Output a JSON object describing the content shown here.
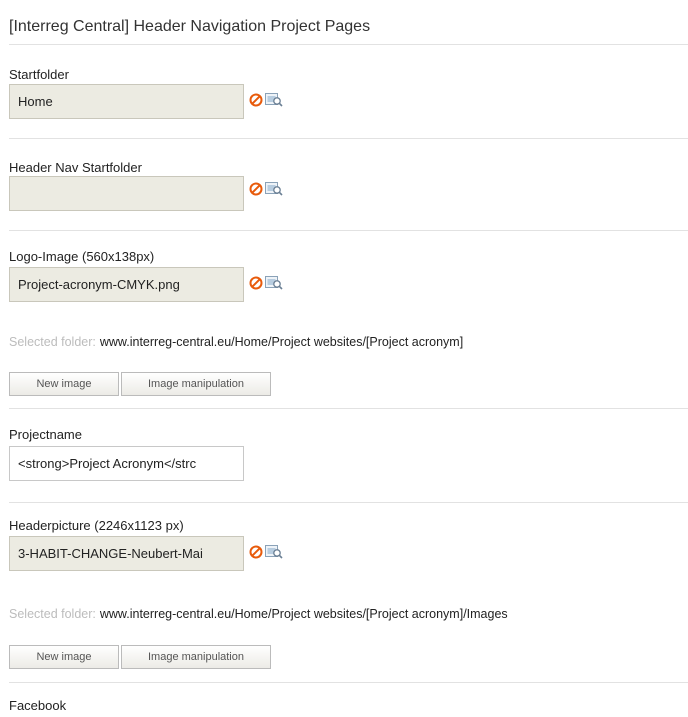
{
  "title": "[Interreg Central] Header Navigation Project Pages",
  "fields": {
    "startfolder": {
      "label": "Startfolder",
      "value": "Home"
    },
    "header_nav_startfolder": {
      "label": "Header Nav Startfolder",
      "value": ""
    },
    "logo_image": {
      "label": "Logo-Image (560x138px)",
      "value": "Project-acronym-CMYK.png"
    },
    "projectname": {
      "label": "Projectname",
      "value": "<strong>Project Acronym</strc"
    },
    "headerpicture": {
      "label": "Headerpicture (2246x1123 px)",
      "value": "3-HABIT-CHANGE-Neubert-Mai"
    },
    "facebook": {
      "label": "Facebook"
    }
  },
  "selected_folder": {
    "key": "Selected folder:",
    "logo_value": "www.interreg-central.eu/Home/Project websites/[Project acronym]",
    "header_value": "www.interreg-central.eu/Home/Project websites/[Project acronym]/Images"
  },
  "buttons": {
    "new_image": "New image",
    "image_manipulation": "Image manipulation"
  },
  "icons": {
    "clear": "cancel-icon",
    "browse": "image-browse-icon"
  },
  "colors": {
    "field_bg": "#ecebe2",
    "clear_icon": "#e85b0c",
    "muted_label": "#bcbcbc"
  }
}
